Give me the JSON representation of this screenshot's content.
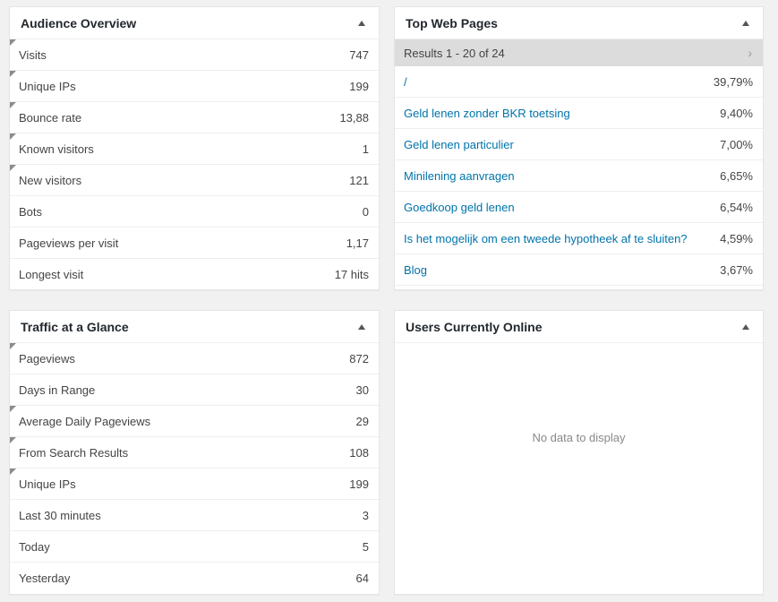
{
  "audience": {
    "title": "Audience Overview",
    "rows": [
      {
        "label": "Visits",
        "value": "747"
      },
      {
        "label": "Unique IPs",
        "value": "199"
      },
      {
        "label": "Bounce rate",
        "value": "13,88"
      },
      {
        "label": "Known visitors",
        "value": "1"
      },
      {
        "label": "New visitors",
        "value": "121"
      },
      {
        "label": "Bots",
        "value": "0"
      },
      {
        "label": "Pageviews per visit",
        "value": "1,17"
      },
      {
        "label": "Longest visit",
        "value": "17 hits"
      }
    ]
  },
  "top_pages": {
    "title": "Top Web Pages",
    "pager_text": "Results 1 - 20 of 24",
    "next_glyph": "›",
    "rows": [
      {
        "label": "/",
        "value": "39,79%"
      },
      {
        "label": "Geld lenen zonder BKR toetsing",
        "value": "9,40%"
      },
      {
        "label": "Geld lenen particulier",
        "value": "7,00%"
      },
      {
        "label": "Minilening aanvragen",
        "value": "6,65%"
      },
      {
        "label": "Goedkoop geld lenen",
        "value": "6,54%"
      },
      {
        "label": "Is het mogelijk om een tweede hypotheek af te sluiten?",
        "value": "4,59%"
      },
      {
        "label": "Blog",
        "value": "3,67%"
      }
    ]
  },
  "traffic": {
    "title": "Traffic at a Glance",
    "rows": [
      {
        "label": "Pageviews",
        "value": "872"
      },
      {
        "label": "Days in Range",
        "value": "30"
      },
      {
        "label": "Average Daily Pageviews",
        "value": "29"
      },
      {
        "label": "From Search Results",
        "value": "108"
      },
      {
        "label": "Unique IPs",
        "value": "199"
      },
      {
        "label": "Last 30 minutes",
        "value": "3"
      },
      {
        "label": "Today",
        "value": "5"
      },
      {
        "label": "Yesterday",
        "value": "64"
      }
    ]
  },
  "online": {
    "title": "Users Currently Online",
    "empty_text": "No data to display"
  }
}
